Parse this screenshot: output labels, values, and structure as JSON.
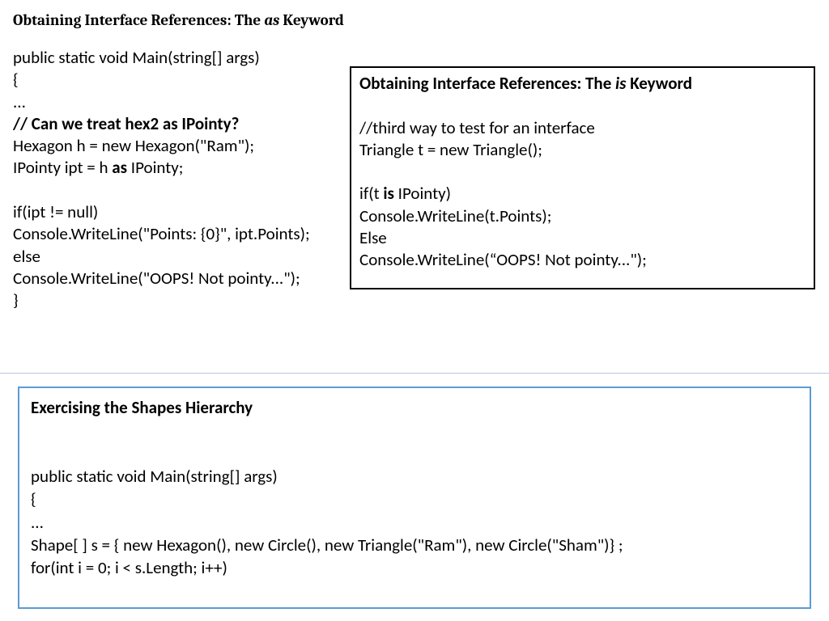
{
  "heading": {
    "pre": "Obtaining Interface References: The ",
    "kw": "as",
    "post": " Keyword"
  },
  "left": {
    "l1": "public static void Main(string[] args)",
    "l2": "{",
    "l3": "...",
    "l4": "// Can we treat hex2 as IPointy?",
    "l5": "Hexagon h = new Hexagon(\"Ram\");",
    "l6a": "IPointy ipt = h ",
    "l6b": "as",
    "l6c": " IPointy;",
    "blank1": " ",
    "l7": "if(ipt != null)",
    "l8": "Console.WriteLine(\"Points: {0}\", ipt.Points);",
    "l9": "else",
    "l10": "Console.WriteLine(\"OOPS! Not pointy...\");",
    "l11": "}"
  },
  "right": {
    "title_pre": "Obtaining Interface References: The ",
    "title_kw": "is",
    "title_post": " Keyword",
    "blank0": " ",
    "l1": " //third way to test for an interface",
    "l2": "Triangle t = new Triangle();",
    "blank1": " ",
    "l3a": "if(t ",
    "l3b": "is",
    "l3c": " IPointy)",
    "l4": "Console.WriteLine(t.Points);",
    "l5": "Else",
    "l6": "Console.WriteLine(“OOPS! Not pointy...\");"
  },
  "bottom": {
    "title": "Exercising the Shapes Hierarchy",
    "blank0": " ",
    "blank1": " ",
    "l1": "public static void Main(string[] args)",
    "l2": "{",
    "l3": "...",
    "l4": "Shape[ ] s = { new Hexagon(), new Circle(), new Triangle(\"Ram\"), new Circle(\"Sham\")} ;",
    "l5": " for(int i = 0; i < s.Length; i++)"
  }
}
